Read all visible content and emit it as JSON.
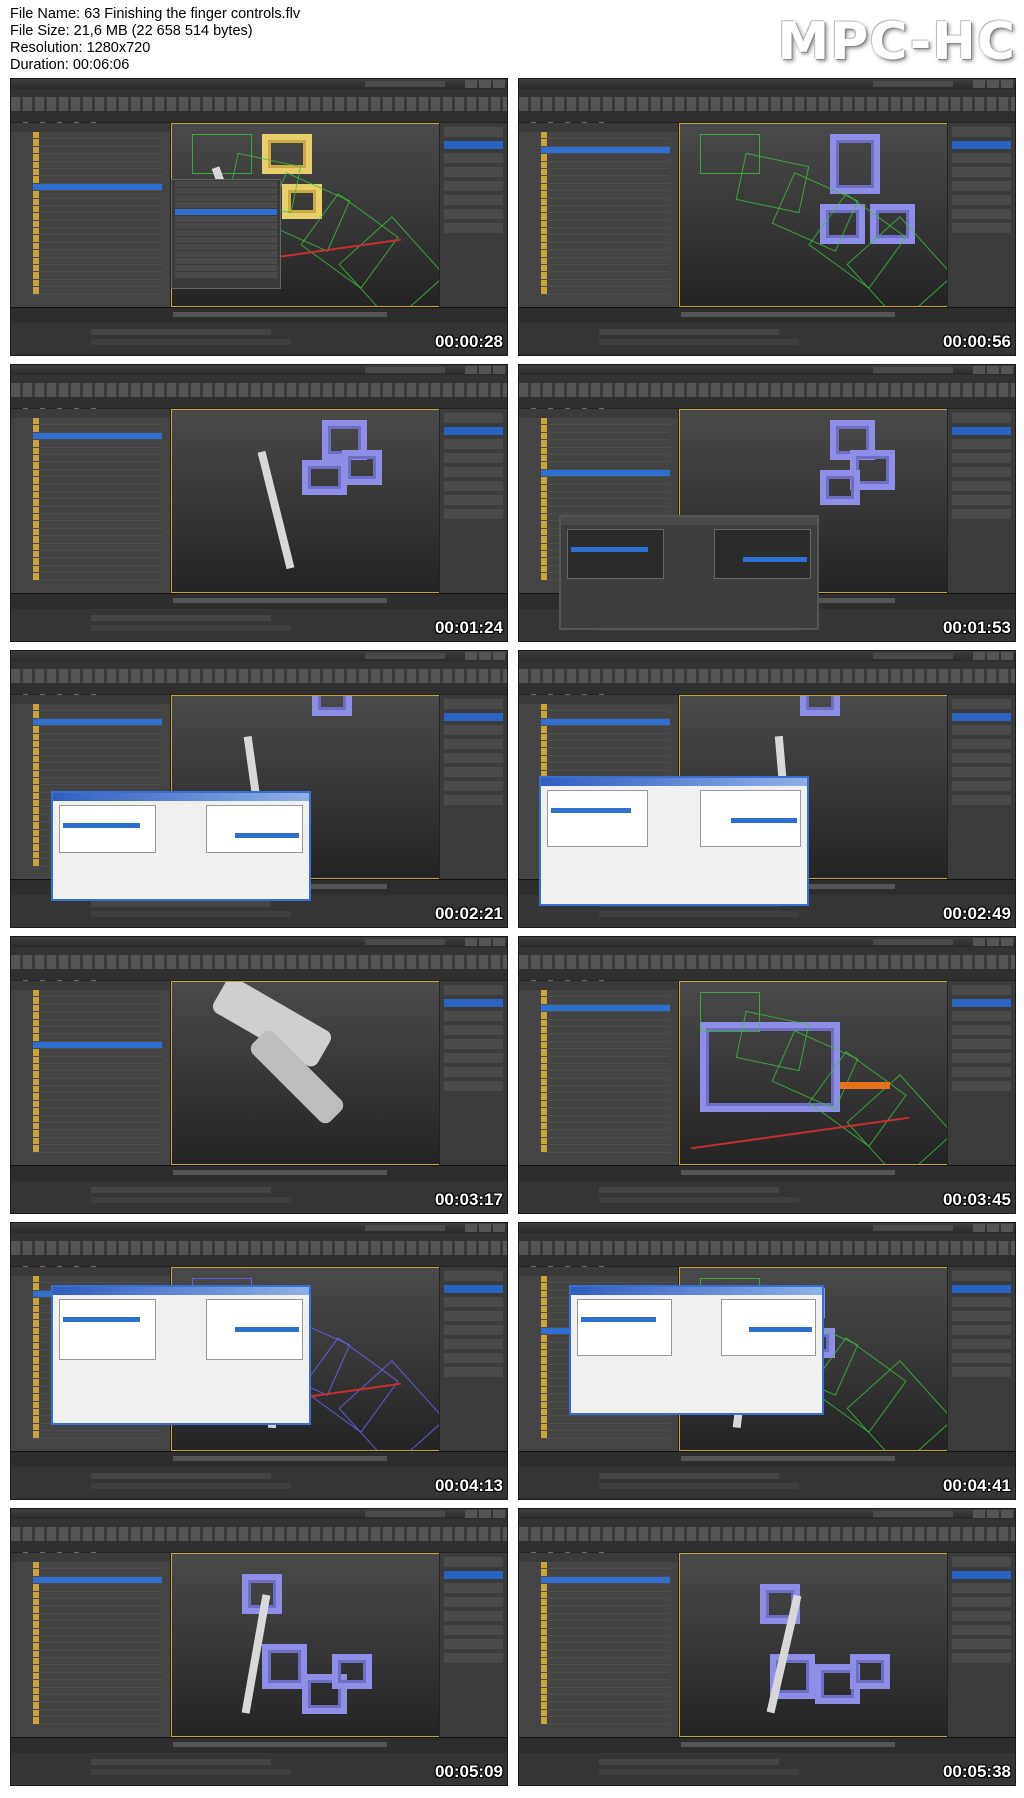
{
  "header": {
    "file_name": "File Name: 63 Finishing the finger controls.flv",
    "file_size": "File Size: 21,6 MB (22 658 514 bytes)",
    "resolution": "Resolution: 1280x720",
    "duration": "Duration: 00:06:06",
    "logo": "MPC-HC"
  },
  "thumbnails": [
    {
      "timestamp": "00:00:28"
    },
    {
      "timestamp": "00:00:56"
    },
    {
      "timestamp": "00:01:24"
    },
    {
      "timestamp": "00:01:53"
    },
    {
      "timestamp": "00:02:21"
    },
    {
      "timestamp": "00:02:49"
    },
    {
      "timestamp": "00:03:17"
    },
    {
      "timestamp": "00:03:45"
    },
    {
      "timestamp": "00:04:13"
    },
    {
      "timestamp": "00:04:41"
    },
    {
      "timestamp": "00:05:09"
    },
    {
      "timestamp": "00:05:38"
    }
  ],
  "colors": {
    "background": "#ffffff",
    "max_ui_dark": "#2b2b2b",
    "selection_blue": "#2f6fd0",
    "cage_purple": "#8e8ee6",
    "viewport_frame": "#c8a636"
  }
}
